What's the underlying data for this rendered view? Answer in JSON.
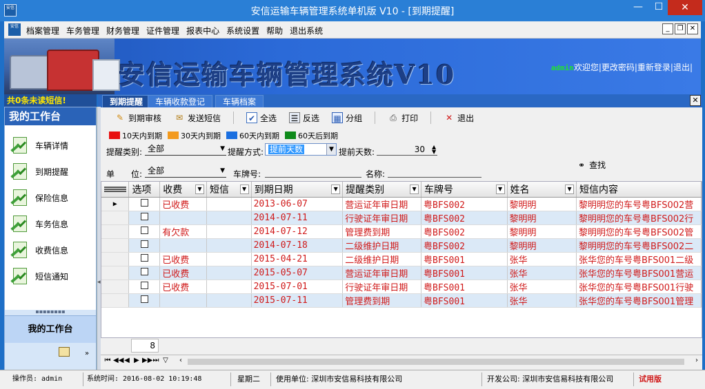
{
  "window": {
    "title": "安信运输车辆管理系统单机版 V10 - [到期提醒]",
    "icon_text": "安信",
    "minimize": "—",
    "maximize": "☐",
    "close": "✕"
  },
  "menu": {
    "items": [
      "档案管理",
      "车务管理",
      "财务管理",
      "证件管理",
      "报表中心",
      "系统设置",
      "帮助",
      "退出系统"
    ]
  },
  "banner": {
    "system_name": "安信运输车辆管理系统V10",
    "user": "admin",
    "links": "欢迎您|更改密码|重新登录|退出|"
  },
  "notice": "共0条未读短信!",
  "tabs": [
    "到期提醒",
    "车辆收款登记",
    "车辆档案"
  ],
  "sidebar": {
    "header": "我的工作台",
    "items": [
      "车辆详情",
      "到期提醒",
      "保险信息",
      "车务信息",
      "收费信息",
      "短信通知"
    ],
    "bottom_header": "我的工作台"
  },
  "toolbar": {
    "audit": "到期审核",
    "send_sms": "发送短信",
    "select_all": "全选",
    "invert": "反选",
    "group": "分组",
    "print": "打印",
    "exit": "退出"
  },
  "legend": [
    {
      "label": "10天内到期",
      "color": "#e81010"
    },
    {
      "label": "30天内到期",
      "color": "#f39a1e"
    },
    {
      "label": "60天内到期",
      "color": "#1a6fe0"
    },
    {
      "label": "60天后到期",
      "color": "#0e8a1a"
    }
  ],
  "filters": {
    "type_label": "提醒类别:",
    "type_value": "全部",
    "method_label": "提醒方式:",
    "method_value": "提前天数",
    "days_label": "提前天数:",
    "days_value": "30",
    "unit_label": "单　　位:",
    "unit_value": "全部",
    "plate_label": "车牌号:",
    "name_label": "名称:",
    "find": "查找"
  },
  "grid": {
    "columns": [
      "选项",
      "收费",
      "短信",
      "到期日期",
      "提醒类别",
      "车牌号",
      "姓名",
      "短信内容"
    ],
    "rows": [
      {
        "fee": "已收费",
        "sms": "",
        "date": "2013-06-07",
        "type": "营运证年审日期",
        "plate": "粤BFS002",
        "name": "黎明明",
        "content": "黎明明您的车号粤BFS002营"
      },
      {
        "fee": "",
        "sms": "",
        "date": "2014-07-11",
        "type": "行驶证年审日期",
        "plate": "粤BFS002",
        "name": "黎明明",
        "content": "黎明明您的车号粤BFS002行"
      },
      {
        "fee": "有欠款",
        "sms": "",
        "date": "2014-07-12",
        "type": "管理费到期",
        "plate": "粤BFS002",
        "name": "黎明明",
        "content": "黎明明您的车号粤BFS002管"
      },
      {
        "fee": "",
        "sms": "",
        "date": "2014-07-18",
        "type": "二级维护日期",
        "plate": "粤BFS002",
        "name": "黎明明",
        "content": "黎明明您的车号粤BFS002二"
      },
      {
        "fee": "已收费",
        "sms": "",
        "date": "2015-04-21",
        "type": "二级维护日期",
        "plate": "粤BFS001",
        "name": "张华",
        "content": "张华您的车号粤BFS001二级"
      },
      {
        "fee": "已收费",
        "sms": "",
        "date": "2015-05-07",
        "type": "营运证年审日期",
        "plate": "粤BFS001",
        "name": "张华",
        "content": "张华您的车号粤BFS001营运"
      },
      {
        "fee": "已收费",
        "sms": "",
        "date": "2015-07-01",
        "type": "行驶证年审日期",
        "plate": "粤BFS001",
        "name": "张华",
        "content": "张华您的车号粤BFS001行驶"
      },
      {
        "fee": "",
        "sms": "",
        "date": "2015-07-11",
        "type": "管理费到期",
        "plate": "粤BFS001",
        "name": "张华",
        "content": "张华您的车号粤BFS001管理"
      }
    ],
    "row_count": "8"
  },
  "status": {
    "operator": "操作员: admin",
    "time": "系统时间: 2016-08-02 10:19:48",
    "weekday": "星期二",
    "user_unit": "使用单位: 深圳市安信易科技有限公司",
    "developer": "开发公司: 深圳市安信易科技有限公司",
    "trial": "试用版"
  }
}
